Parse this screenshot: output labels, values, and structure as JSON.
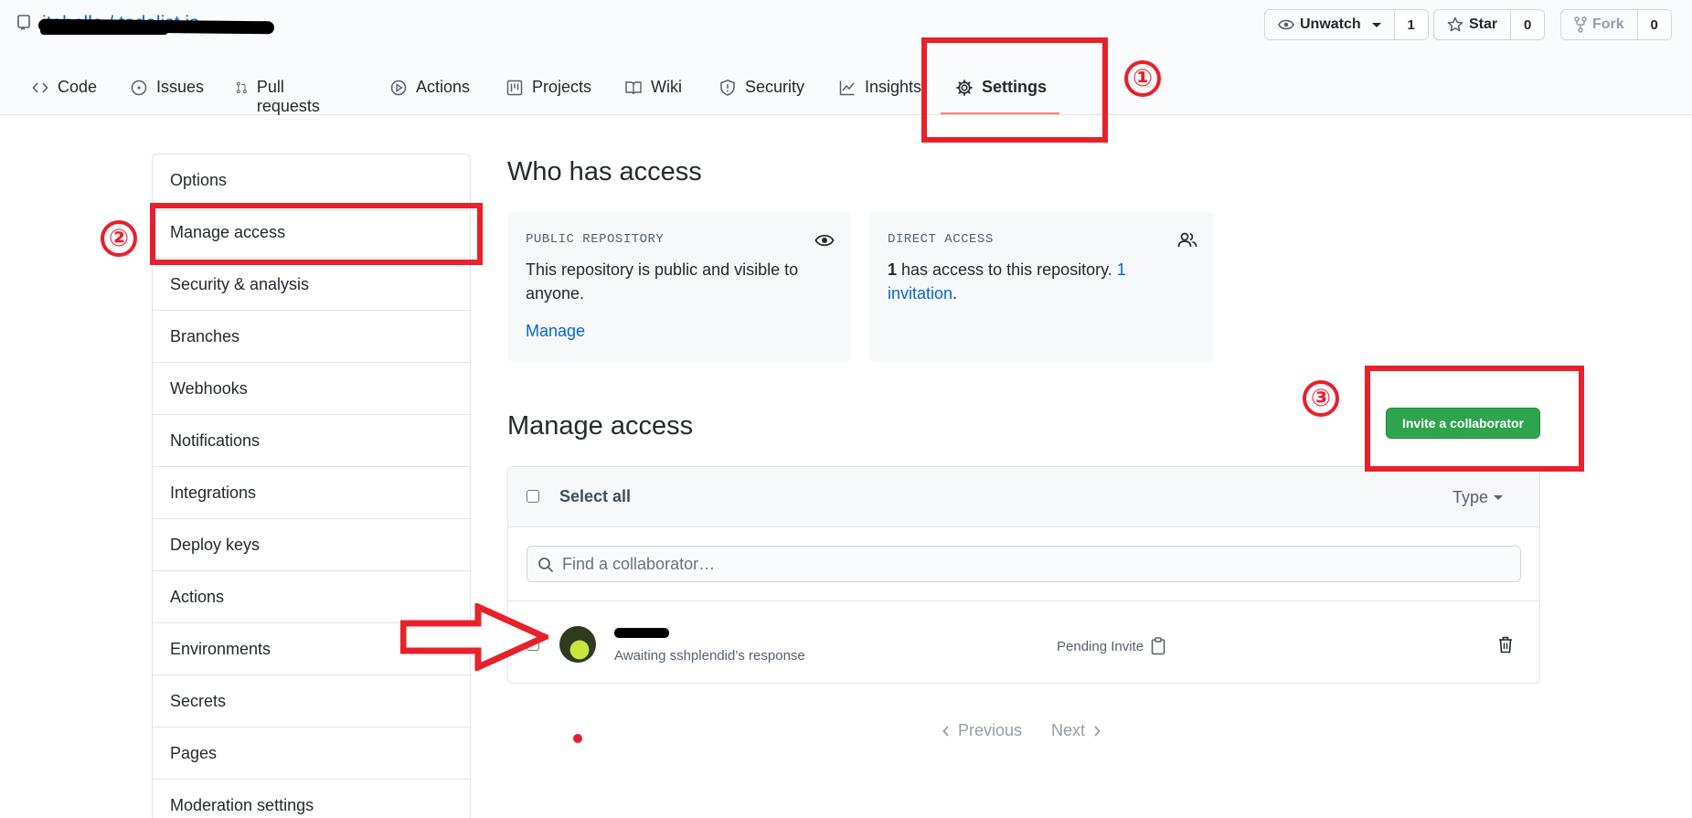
{
  "repo": {
    "path": "itabella / todolist.js"
  },
  "repo_actions": {
    "unwatch_label": "Unwatch",
    "unwatch_count": "1",
    "star_label": "Star",
    "star_count": "0",
    "fork_label": "Fork",
    "fork_count": "0"
  },
  "tabs": [
    {
      "label": "Code",
      "icon": "code-icon"
    },
    {
      "label": "Issues",
      "icon": "issue-icon"
    },
    {
      "label": "Pull requests",
      "icon": "pull-request-icon"
    },
    {
      "label": "Actions",
      "icon": "play-icon"
    },
    {
      "label": "Projects",
      "icon": "project-icon"
    },
    {
      "label": "Wiki",
      "icon": "book-icon"
    },
    {
      "label": "Security",
      "icon": "shield-icon"
    },
    {
      "label": "Insights",
      "icon": "graph-icon"
    },
    {
      "label": "Settings",
      "icon": "gear-icon",
      "active": true
    }
  ],
  "annotations": [
    "①",
    "②",
    "③"
  ],
  "sidebar": {
    "items": [
      "Options",
      "Manage access",
      "Security & analysis",
      "Branches",
      "Webhooks",
      "Notifications",
      "Integrations",
      "Deploy keys",
      "Actions",
      "Environments",
      "Secrets",
      "Pages",
      "Moderation settings"
    ]
  },
  "who_has_access": {
    "title": "Who has access",
    "public_card": {
      "label": "PUBLIC REPOSITORY",
      "text": "This repository is public and visible to anyone.",
      "manage_link": "Manage"
    },
    "direct_card": {
      "label": "DIRECT ACCESS",
      "count": "1",
      "text": " has access to this repository. ",
      "invite_link": "1 invitation",
      "period": "."
    }
  },
  "manage_access": {
    "title": "Manage access",
    "invite_button": "Invite a collaborator",
    "select_all": "Select all",
    "type_filter": "Type",
    "search_placeholder": "Find a collaborator…",
    "collaborator": {
      "status_text": "Awaiting sshplendid’s response",
      "pending_label": "Pending Invite"
    },
    "pagination": {
      "previous": "Previous",
      "next": "Next"
    }
  },
  "colors": {
    "accent": "#0366d6",
    "annotation": "#e8202a",
    "invite_button": "#2ea44f",
    "tab_underline": "#f9826c"
  }
}
